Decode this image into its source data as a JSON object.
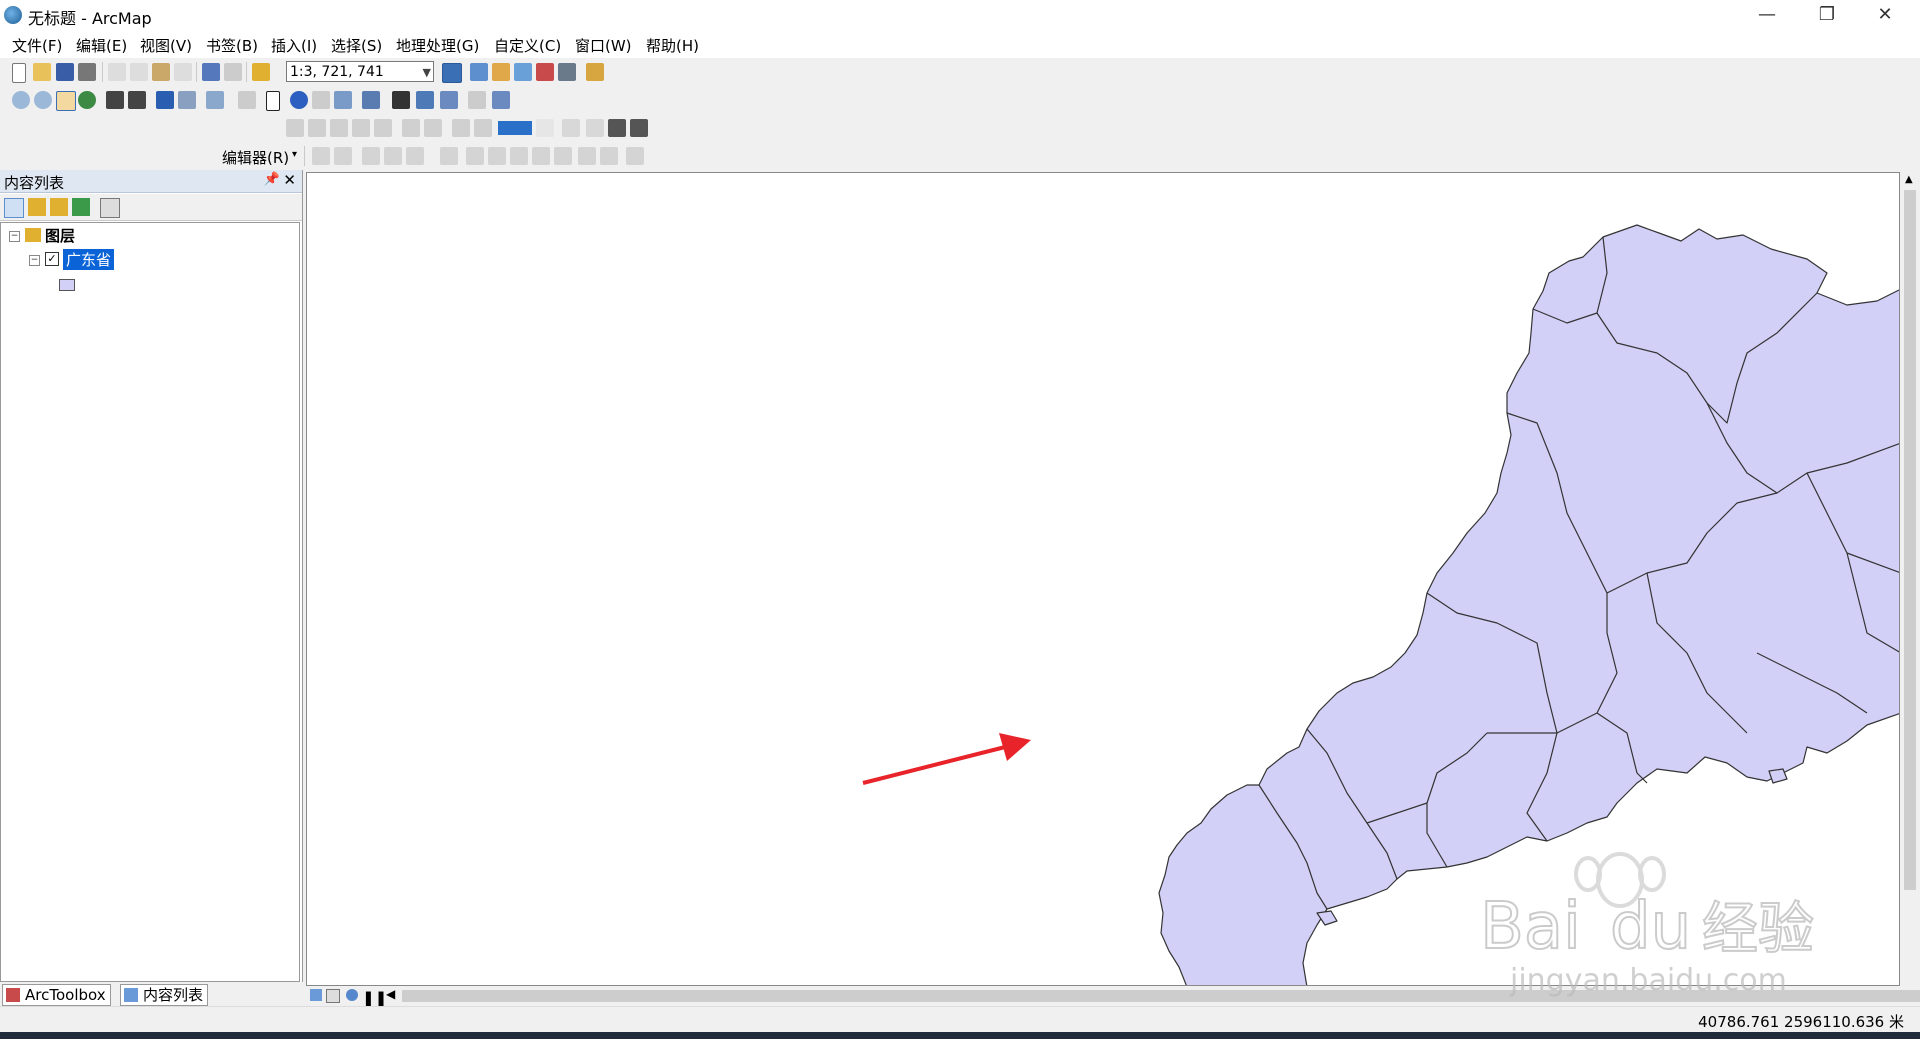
{
  "window": {
    "title": "无标题 - ArcMap",
    "minimize": "—",
    "maximize": "❐",
    "close": "✕"
  },
  "menu": [
    "文件(F)",
    "编辑(E)",
    "视图(V)",
    "书签(B)",
    "插入(I)",
    "选择(S)",
    "地理处理(G)",
    "自定义(C)",
    "窗口(W)",
    "帮助(H)"
  ],
  "toolbar": {
    "scale": "1:3, 721, 741",
    "editor_label": "编辑器(R)"
  },
  "toc": {
    "title": "内容列表",
    "root_label": "图层",
    "layer_name": "广东省",
    "layer_checked": true,
    "symbol_color": "#d3d0f7"
  },
  "bottom_tabs": [
    "ArcToolbox",
    "内容列表"
  ],
  "status": {
    "coordinates": "40786.761  2596110.636 米"
  },
  "map": {
    "fill": "#d3d0f7",
    "stroke": "#333333",
    "arrow_color": "#e8242a"
  },
  "watermark": {
    "brand": "Bai",
    "brand2": "du",
    "cn": "经验",
    "url": "jingyan.baidu.com"
  }
}
